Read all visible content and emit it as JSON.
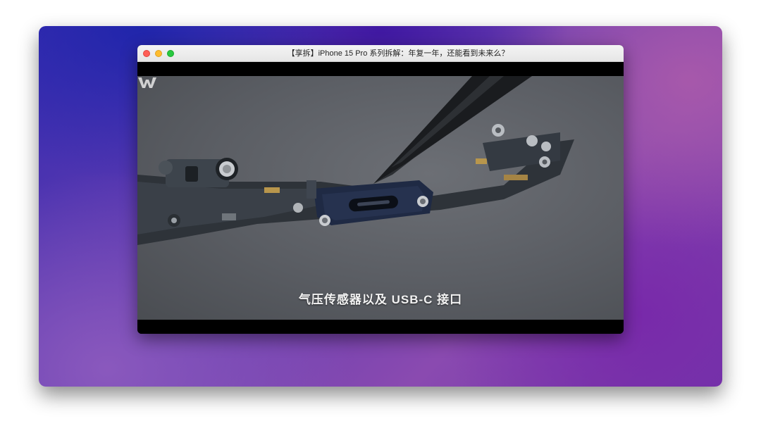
{
  "window": {
    "title": "【享拆】iPhone 15 Pro 系列拆解：年复一年，还能看到未来么？"
  },
  "video": {
    "subtitle": "气压传感器以及 USB-C 接口",
    "channel_logo_icon": "w-logo-icon"
  },
  "colors": {
    "close": "#fe5f57",
    "minimize": "#febc2e",
    "zoom": "#28c840"
  }
}
